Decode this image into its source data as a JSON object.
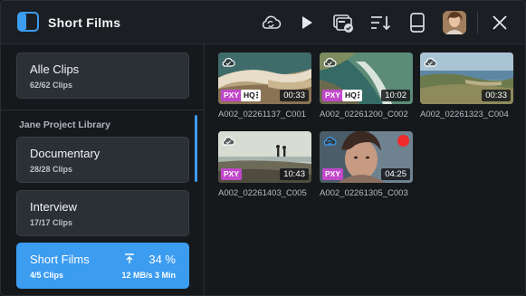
{
  "header": {
    "title": "Short Films",
    "icons": [
      "sidebar-toggle-icon",
      "cloud-sync-icon",
      "play-icon",
      "cards-check-icon",
      "sort-icon",
      "drive-icon",
      "avatar",
      "close-icon"
    ]
  },
  "sidebar": {
    "all_clips": {
      "label": "Alle Clips",
      "count": "62/62 Clips"
    },
    "library_title": "Jane Project Library",
    "projects": [
      {
        "label": "Documentary",
        "count": "28/28 Clips"
      },
      {
        "label": "Interview",
        "count": "17/17 Clips"
      },
      {
        "label": "Short Films",
        "count": "4/5 Clips",
        "progress": "34 %",
        "speed": "12 MB/s 3 Min",
        "active": true
      }
    ]
  },
  "clips": [
    {
      "name": "A002_02261137_C001",
      "duration": "00:33",
      "badges": [
        "PXY",
        "HQ"
      ],
      "cloud": "uploaded"
    },
    {
      "name": "A002_02261200_C002",
      "duration": "10:02",
      "badges": [
        "PXY",
        "HQ"
      ],
      "cloud": "uploaded"
    },
    {
      "name": "A002_02261323_C004",
      "duration": "00:33",
      "badges": [],
      "cloud": "uploaded"
    },
    {
      "name": "A002_02261403_C005",
      "duration": "10:43",
      "badges": [
        "PXY"
      ],
      "cloud": "uploaded"
    },
    {
      "name": "A002_02261305_C003",
      "duration": "04:25",
      "badges": [
        "PXY"
      ],
      "cloud": "syncing",
      "recording": true
    }
  ],
  "colors": {
    "accent": "#3b9cf0",
    "proxy_badge": "#c048c9",
    "record": "#ef2b2b"
  }
}
